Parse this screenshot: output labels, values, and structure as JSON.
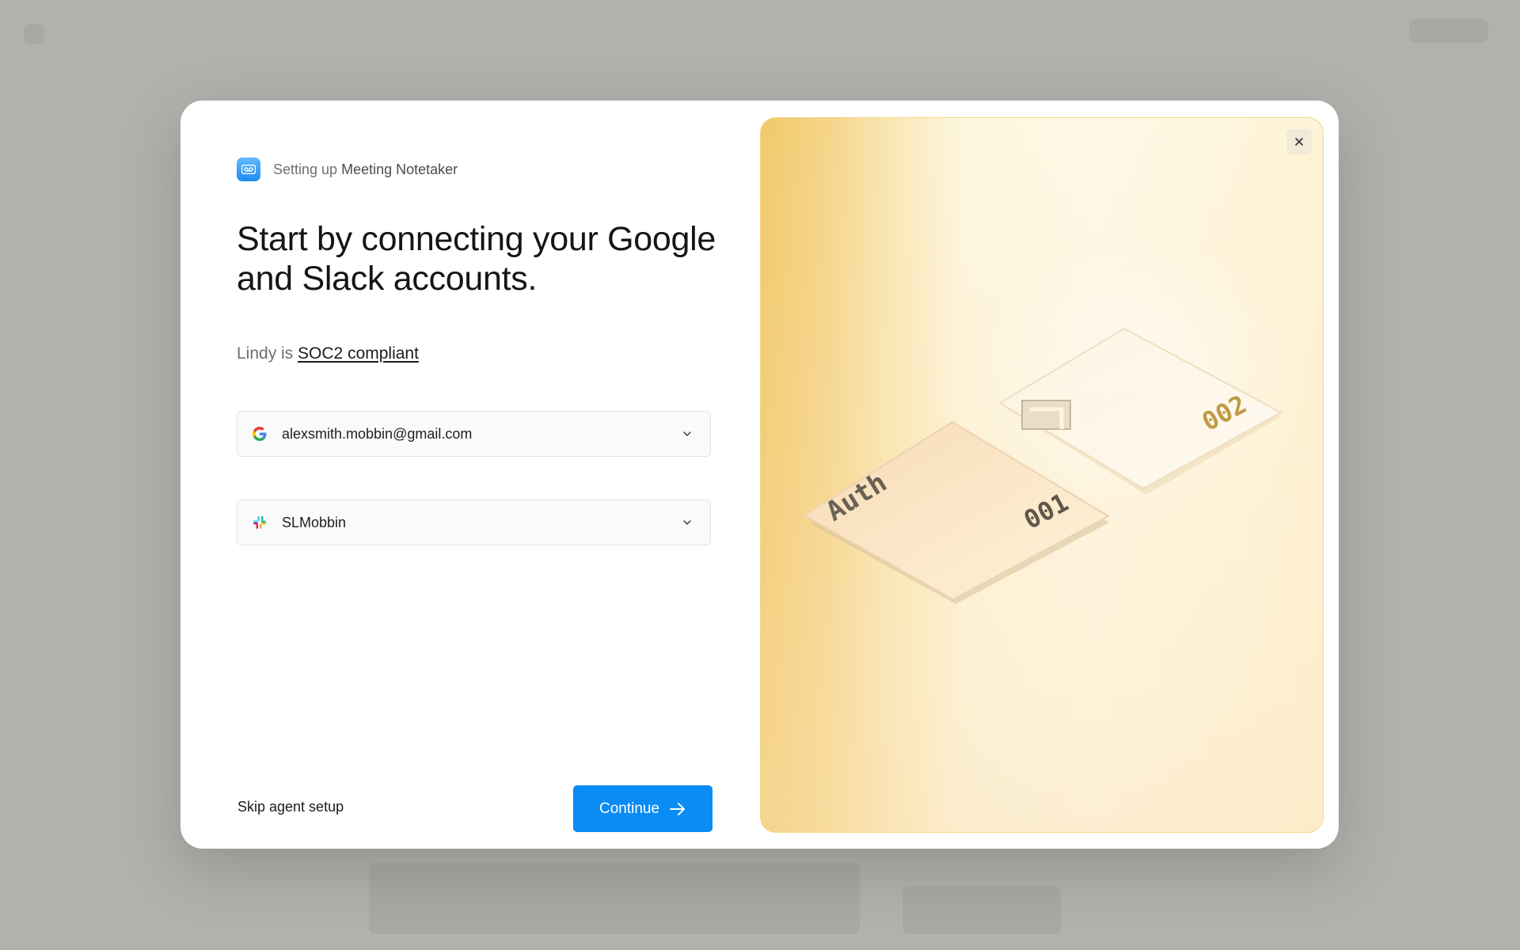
{
  "setup": {
    "prefix": "Setting up",
    "agent_name": "Meeting Notetaker"
  },
  "headline": "Start by connecting your Google and Slack accounts.",
  "compliance": {
    "prefix": "Lindy is",
    "link": "SOC2 compliant"
  },
  "accounts": {
    "google": {
      "value": "alexsmith.mobbin@gmail.com",
      "icon": "google-icon"
    },
    "slack": {
      "value": "SLMobbin",
      "icon": "slack-icon"
    }
  },
  "actions": {
    "skip_label": "Skip agent setup",
    "continue_label": "Continue"
  },
  "illustration": {
    "card_label": "Auth",
    "card_1_number": "001",
    "card_2_number": "002"
  },
  "colors": {
    "accent": "#0a8cf5",
    "illustration_gold": "#f1c96a"
  }
}
